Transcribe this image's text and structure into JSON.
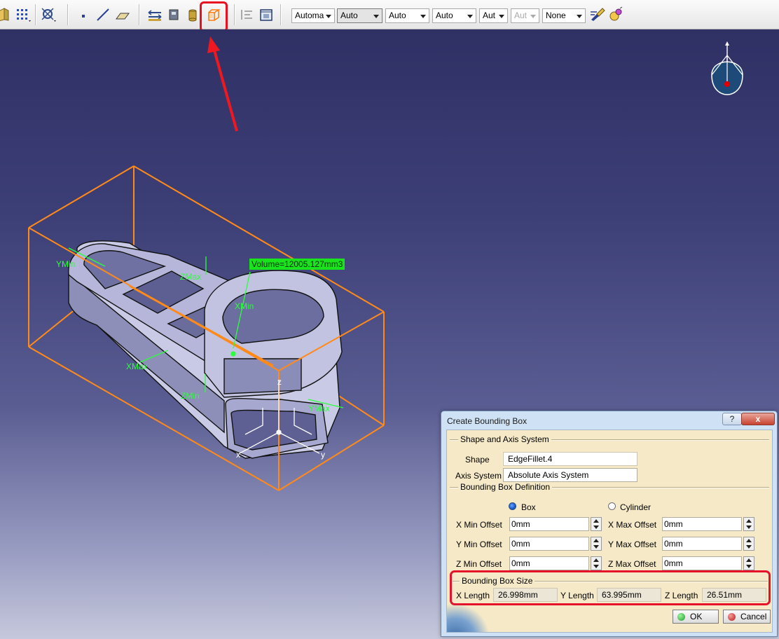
{
  "toolbar": {
    "combos": [
      {
        "value": "Automa",
        "disabled": false
      },
      {
        "value": "Auto",
        "disabled": false
      },
      {
        "value": "Auto",
        "disabled": false
      },
      {
        "value": "Auto",
        "disabled": false
      },
      {
        "value": "Aut",
        "disabled": false
      },
      {
        "value": "Aut",
        "disabled": true
      },
      {
        "value": "None",
        "disabled": false
      }
    ]
  },
  "viewport": {
    "volume_label": "Volume=12005.127mm3",
    "labels": {
      "ymin_left": "YMin",
      "zmax": "ZMax",
      "xmin": "XMin",
      "xmax": "XMax",
      "zmin": "ZMin",
      "ymax": "YMax",
      "axis_z": "z",
      "axis_x": "x",
      "axis_y": "y"
    }
  },
  "dialog": {
    "title": "Create Bounding Box",
    "help_label": "?",
    "close_label": "x",
    "shape_group": {
      "title": "Shape and Axis System",
      "shape_label": "Shape",
      "shape_value": "EdgeFillet.4",
      "axis_label": "Axis System",
      "axis_value": "Absolute Axis System"
    },
    "definition_group": {
      "title": "Bounding Box Definition",
      "box_label": "Box",
      "cylinder_label": "Cylinder",
      "selected": "Box",
      "x_min_label": "X Min Offset",
      "x_min_value": "0mm",
      "x_max_label": "X Max Offset",
      "x_max_value": "0mm",
      "y_min_label": "Y Min Offset",
      "y_min_value": "0mm",
      "y_max_label": "Y Max Offset",
      "y_max_value": "0mm",
      "z_min_label": "Z Min Offset",
      "z_min_value": "0mm",
      "z_max_label": "Z Max Offset",
      "z_max_value": "0mm"
    },
    "size_group": {
      "title": "Bounding Box Size",
      "x_label": "X Length",
      "x_value": "26.998mm",
      "y_label": "Y Length",
      "y_value": "63.995mm",
      "z_label": "Z Length",
      "z_value": "26.51mm"
    },
    "ok_label": "OK",
    "cancel_label": "Cancel"
  },
  "colors": {
    "highlight": "#e8101e",
    "bounding_box": "#ff8a1a",
    "annotation_green": "#2cff3c",
    "part_fill": "#b9badb"
  }
}
